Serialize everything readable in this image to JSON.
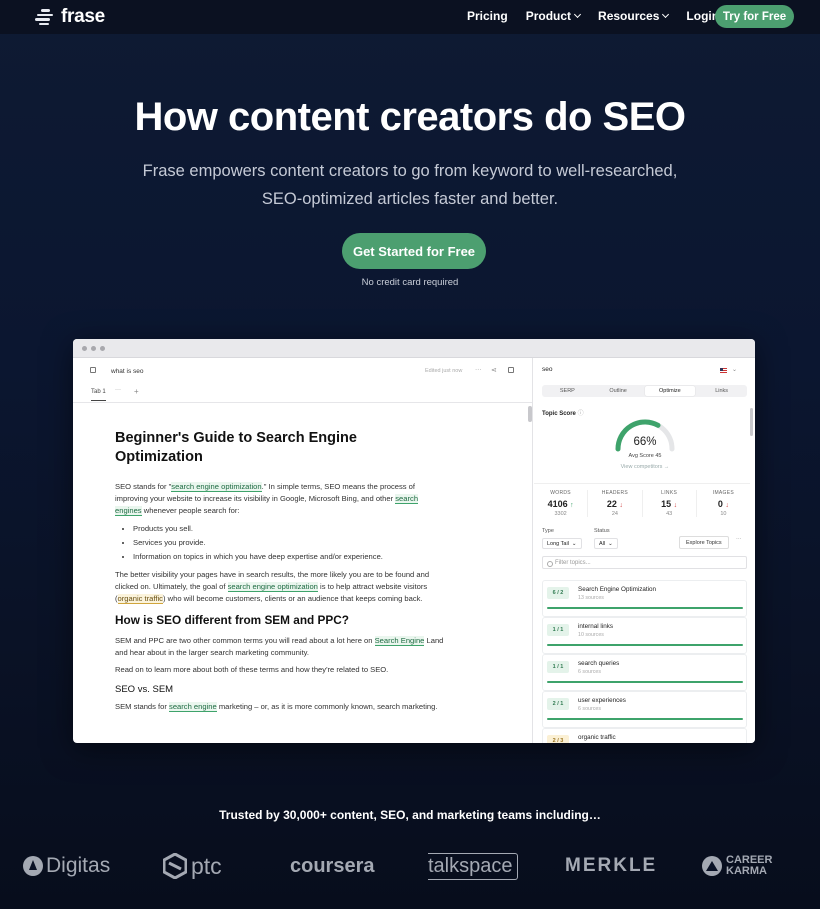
{
  "nav": {
    "brand": "frase",
    "links": [
      {
        "label": "Pricing",
        "dropdown": false
      },
      {
        "label": "Product",
        "dropdown": true
      },
      {
        "label": "Resources",
        "dropdown": true
      },
      {
        "label": "Login",
        "dropdown": false
      }
    ],
    "cta": "Try for Free"
  },
  "hero": {
    "title": "How content creators do SEO",
    "subtitle": "Frase empowers content creators to go from keyword to well-researched, SEO-optimized articles faster and better.",
    "cta": "Get Started for Free",
    "note": "No credit card required"
  },
  "app": {
    "doc_title": "what is seo",
    "edited": "Edited just now",
    "tab": "Tab 1",
    "tab_more": "···",
    "tab_add": "+",
    "heading": "Beginner's Guide to Search Engine Optimization",
    "p1_a": "SEO stands for \"",
    "p1_h1": "search engine optimization",
    "p1_b": ".\" In simple terms, SEO means the process of improving your website to increase its visibility in Google, Microsoft Bing, and other ",
    "p1_h2": "search engines",
    "p1_c": " whenever people search for:",
    "bullets": [
      "Products you sell.",
      "Services you provide.",
      "Information on topics in which you have deep expertise and/or experience."
    ],
    "p2_a": "The better visibility your pages have in search results, the more likely you are to be found and clicked on. Ultimately, the goal of ",
    "p2_h1": "search engine optimization",
    "p2_b": " is to help attract website visitors (",
    "p2_h2": "organic traffic",
    "p2_c": ") who will become customers, clients or an audience that keeps coming back.",
    "h2": "How is SEO different from SEM and PPC?",
    "p3_a": "SEM and PPC are two other common terms you will read about a lot here on ",
    "p3_h": "Search Engine",
    "p3_b": " Land and hear about in the larger search marketing community.",
    "p4": "Read on to learn more about both of these terms and how they're related to SEO.",
    "h3": "SEO vs. SEM",
    "p5_a": "SEM stands for ",
    "p5_h": "search engine",
    "p5_b": " marketing – or, as it is more commonly known, search marketing."
  },
  "panel": {
    "query": "seo",
    "tabs": [
      "SERP",
      "Outline",
      "Optimize",
      "Links"
    ],
    "active_tab": "Optimize",
    "topic_score_label": "Topic Score",
    "score": "66%",
    "score_fraction": 0.66,
    "avg_score": "Avg Score 45",
    "view_competitors": "View competitors →",
    "stats": [
      {
        "label": "WORDS",
        "value": "4106",
        "dir": "up",
        "target": "3302"
      },
      {
        "label": "HEADERS",
        "value": "22",
        "dir": "down",
        "target": "24"
      },
      {
        "label": "LINKS",
        "value": "15",
        "dir": "down",
        "target": "43"
      },
      {
        "label": "IMAGES",
        "value": "0",
        "dir": "down",
        "target": "10"
      }
    ],
    "type_label": "Type",
    "type_value": "Long Tail",
    "status_label": "Status",
    "status_value": "All",
    "explore": "Explore Topics",
    "more": "···",
    "filter_placeholder": "Filter topics...",
    "topics": [
      {
        "badge": "6 / 2",
        "name": "Search Engine Optimization",
        "sources": "13 sources"
      },
      {
        "badge": "1 / 1",
        "name": "internal links",
        "sources": "10 sources"
      },
      {
        "badge": "1 / 1",
        "name": "search queries",
        "sources": "6 sources"
      },
      {
        "badge": "2 / 1",
        "name": "user experiences",
        "sources": "6 sources"
      },
      {
        "badge": "2 / 3",
        "name": "organic traffic",
        "sources": ""
      }
    ]
  },
  "trusted": {
    "text": "Trusted by 30,000+ content, SEO, and marketing teams including…",
    "logos": [
      "Digitas",
      "ptc",
      "coursera",
      "talkspace",
      "MERKLE",
      "CAREER KARMA"
    ]
  }
}
